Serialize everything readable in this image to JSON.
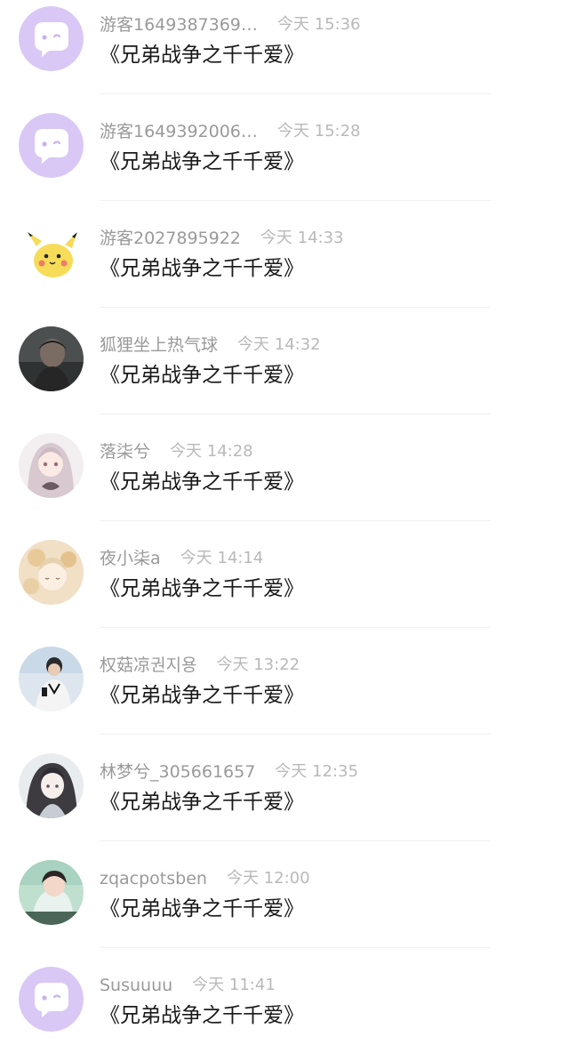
{
  "comments": [
    {
      "name": "游客1649387369…",
      "time": "今天 15:36",
      "text": "《兄弟战争之千千爱》",
      "avatar": "default-chat-avatar"
    },
    {
      "name": "游客1649392006…",
      "time": "今天 15:28",
      "text": "《兄弟战争之千千爱》",
      "avatar": "default-chat-avatar"
    },
    {
      "name": "游客2027895922",
      "time": "今天 14:33",
      "text": "《兄弟战争之千千爱》",
      "avatar": "pikachu-avatar"
    },
    {
      "name": "狐狸坐上热气球",
      "time": "今天 14:32",
      "text": "《兄弟战争之千千爱》",
      "avatar": "photo-avatar"
    },
    {
      "name": "落柒兮",
      "time": "今天 14:28",
      "text": "《兄弟战争之千千爱》",
      "avatar": "anime-girl-avatar"
    },
    {
      "name": "夜小柒a",
      "time": "今天 14:14",
      "text": "《兄弟战争之千千爱》",
      "avatar": "anime-gold-avatar"
    },
    {
      "name": "权菇凉권지용",
      "time": "今天 13:22",
      "text": "《兄弟战争之千千爱》",
      "avatar": "person-photo-avatar"
    },
    {
      "name": "林梦兮_305661657",
      "time": "今天 12:35",
      "text": "《兄弟战争之千千爱》",
      "avatar": "anime-lady-avatar"
    },
    {
      "name": "zqacpotsben",
      "time": "今天 12:00",
      "text": "《兄弟战争之千千爱》",
      "avatar": "portrait-photo-avatar"
    },
    {
      "name": "Susuuuu",
      "time": "今天 11:41",
      "text": "《兄弟战争之千千爱》",
      "avatar": "default-chat-avatar"
    }
  ],
  "colors": {
    "default_avatar_bg": "#d9c7f5",
    "name_text": "#9a9a9a",
    "time_text": "#b9b9b9",
    "content_text": "#1a1a1a"
  }
}
